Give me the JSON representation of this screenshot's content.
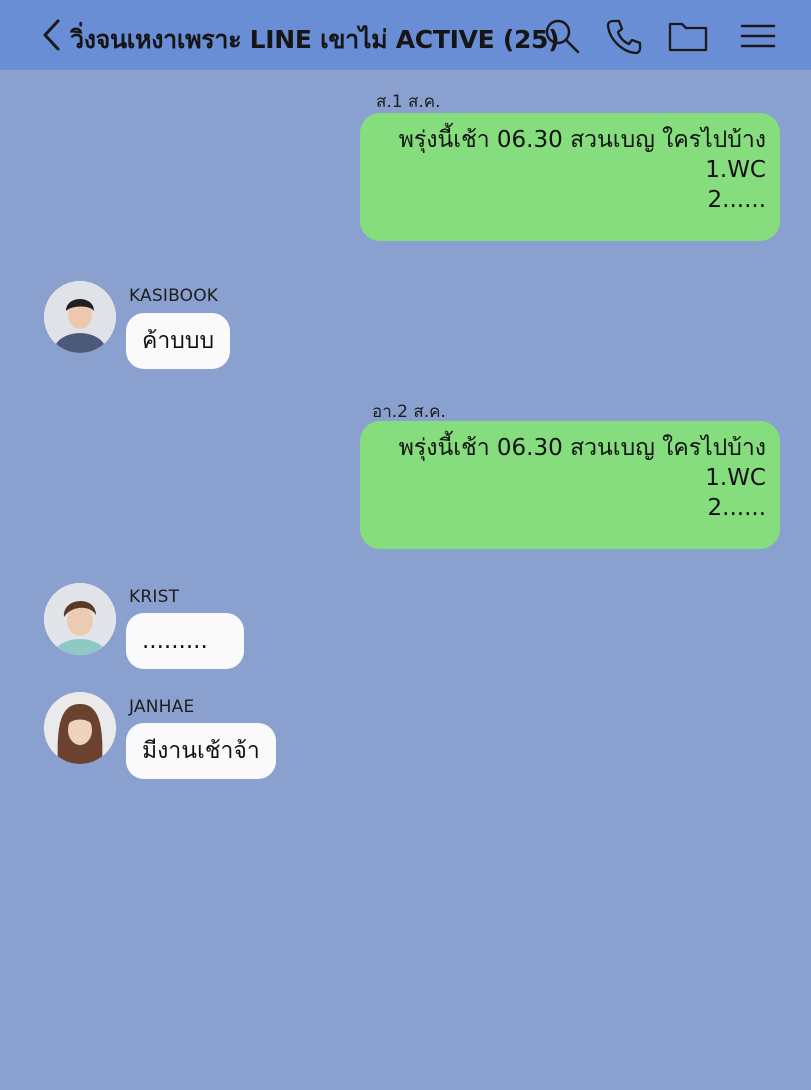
{
  "header": {
    "title": "วิ่งจนเหงาเพราะ LINE เขาไม่ ACTIVE (25)",
    "icons": [
      "chevron-left-icon",
      "search-icon",
      "phone-icon",
      "folder-icon",
      "menu-icon"
    ]
  },
  "messages": [
    {
      "date": "ส.1 ส.ค.",
      "lines": [
        "พรุ่งนี้เช้า 06.30 สวนเบญ ใครไปบ้าง",
        "1.WC",
        "2......"
      ]
    },
    {
      "sender": "KASIBOOK",
      "text": "ค้าบบบ"
    },
    {
      "date": "อา.2 ส.ค.",
      "lines": [
        "พรุ่งนี้เช้า 06.30 สวนเบญ ใครไปบ้าง",
        "1.WC",
        "2......"
      ]
    },
    {
      "sender": "KRIST",
      "text": "........."
    },
    {
      "sender": "JANHAE",
      "text": "มีงานเช้าจ้า"
    }
  ],
  "colors": {
    "header": "#6a8ed6",
    "background": "#8aa1cf",
    "outgoing_bubble": "#85dd7d",
    "incoming_bubble": "#fafafa"
  }
}
